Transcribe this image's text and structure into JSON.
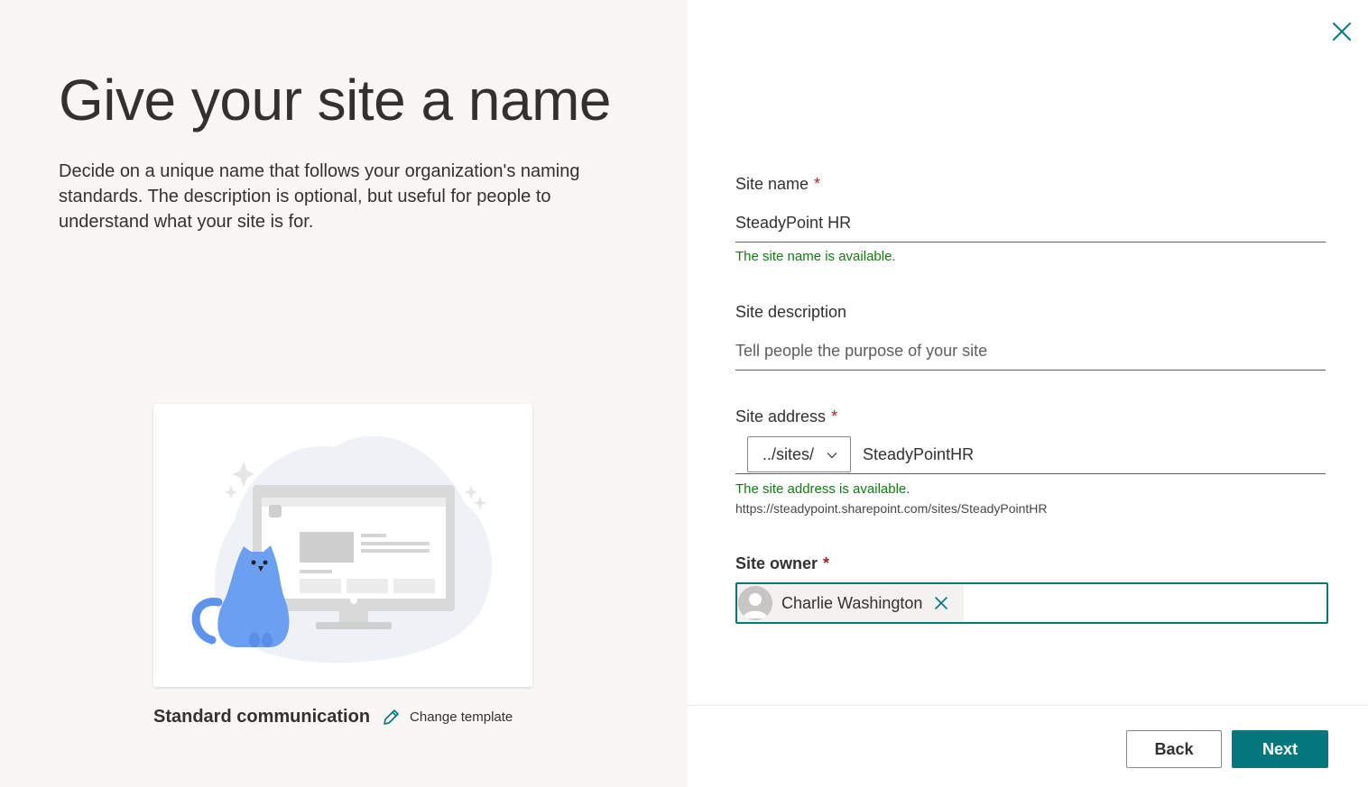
{
  "left": {
    "title": "Give your site a name",
    "description": "Decide on a unique name that follows your organization's naming standards. The description is optional, but useful for people to understand what your site is for.",
    "template_name": "Standard communication",
    "change_template_label": "Change template",
    "icons": {
      "edit": "pencil-icon",
      "illustration": "cat-monitor-illustration"
    }
  },
  "dialog": {
    "close_icon": "close-icon"
  },
  "form": {
    "site_name": {
      "label": "Site name",
      "required_mark": "*",
      "value": "SteadyPoint HR",
      "status": "The site name is available."
    },
    "site_description": {
      "label": "Site description",
      "placeholder": "Tell people the purpose of your site",
      "value": ""
    },
    "site_address": {
      "label": "Site address",
      "required_mark": "*",
      "prefix_option": "../sites/",
      "value": "SteadyPointHR",
      "status": "The site address is available.",
      "url": "https://steadypoint.sharepoint.com/sites/SteadyPointHR"
    },
    "site_owner": {
      "label": "Site owner",
      "required_mark": "*",
      "owner_name": "Charlie Washington"
    }
  },
  "actions": {
    "back_label": "Back",
    "next_label": "Next"
  },
  "colors": {
    "accent": "#03787c",
    "success": "#107c10",
    "required": "#a4262c",
    "left_background": "#f8f7f6",
    "illustration_cat": "#6b9ff0"
  }
}
